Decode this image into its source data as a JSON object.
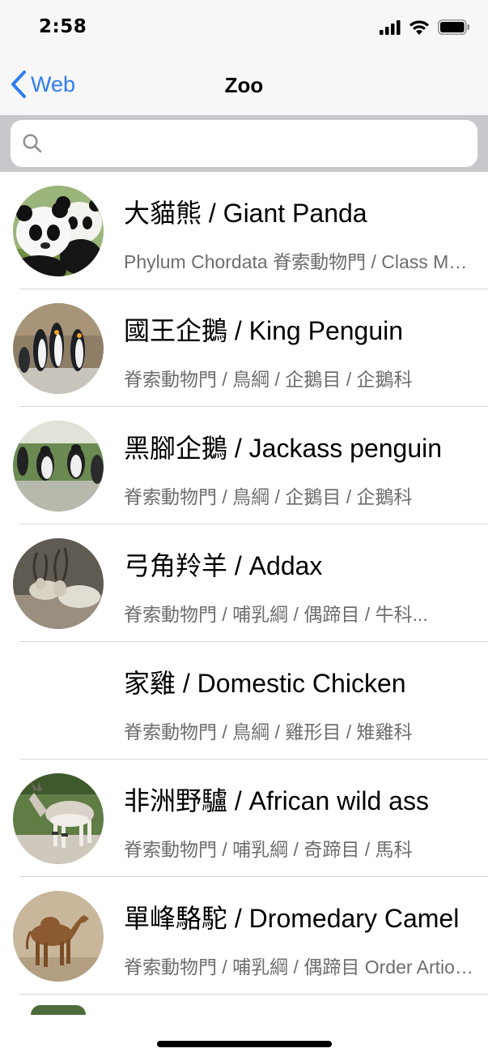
{
  "status_bar": {
    "time": "2:58"
  },
  "nav": {
    "back_label": "Web",
    "title": "Zoo"
  },
  "search": {
    "placeholder": ""
  },
  "animals": [
    {
      "title": "大貓熊 / Giant Panda",
      "subtitle": "Phylum Chordata 脊索動物門 / Class Mammalia"
    },
    {
      "title": "國王企鵝 / King Penguin",
      "subtitle": "脊索動物門 / 鳥綱 / 企鵝目 / 企鵝科"
    },
    {
      "title": "黑腳企鵝 / Jackass penguin",
      "subtitle": "脊索動物門 / 鳥綱 / 企鵝目 / 企鵝科"
    },
    {
      "title": "弓角羚羊 / Addax",
      "subtitle": "脊索動物門 / 哺乳綱 / 偶蹄目 / 牛科..."
    },
    {
      "title": "家雞 / Domestic Chicken",
      "subtitle": "脊索動物門 / 鳥綱 / 雞形目 / 雉雞科"
    },
    {
      "title": "非洲野驢 / African wild ass",
      "subtitle": "脊索動物門 / 哺乳綱 / 奇蹄目 / 馬科"
    },
    {
      "title": "單峰駱駝 / Dromedary Camel",
      "subtitle": "脊索動物門 / 哺乳綱 / 偶蹄目 Order Artiodactyla"
    }
  ]
}
